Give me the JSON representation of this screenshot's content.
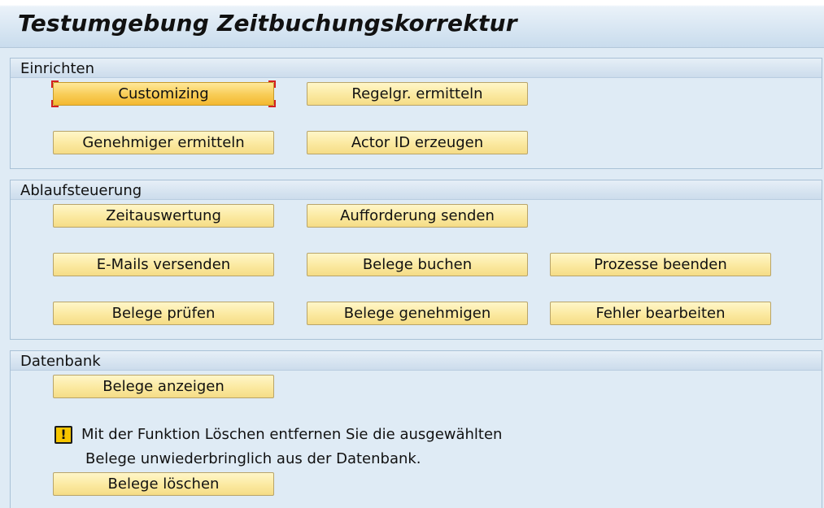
{
  "window": {
    "title": "Testumgebung Zeitbuchungskorrektur"
  },
  "groups": {
    "einrichten": {
      "label": "Einrichten",
      "buttons": {
        "customizing": "Customizing",
        "regelgr": "Regelgr. ermitteln",
        "genehmiger": "Genehmiger ermitteln",
        "actor_id": "Actor ID erzeugen"
      }
    },
    "ablaufsteuerung": {
      "label": "Ablaufsteuerung",
      "buttons": {
        "zeitauswertung": "Zeitauswertung",
        "aufforderung": "Aufforderung senden",
        "emails": "E-Mails versenden",
        "belege_buchen": "Belege buchen",
        "prozesse_beenden": "Prozesse beenden",
        "belege_pruefen": "Belege prüfen",
        "belege_genehmigen": "Belege genehmigen",
        "fehler_bearbeiten": "Fehler bearbeiten"
      }
    },
    "datenbank": {
      "label": "Datenbank",
      "buttons": {
        "belege_anzeigen": "Belege anzeigen",
        "belege_loeschen": "Belege löschen"
      },
      "warning": {
        "icon": "warning-icon",
        "icon_glyph": "!",
        "line1": "Mit der Funktion Löschen entfernen Sie die ausgewählten",
        "line2": "Belege unwiederbringlich aus der Datenbank."
      }
    }
  },
  "colors": {
    "background": "#dfebf5",
    "button": "#fbe9a0",
    "button_focused": "#f8cc55",
    "focus_marker": "#d42020",
    "warning": "#f7c600"
  }
}
